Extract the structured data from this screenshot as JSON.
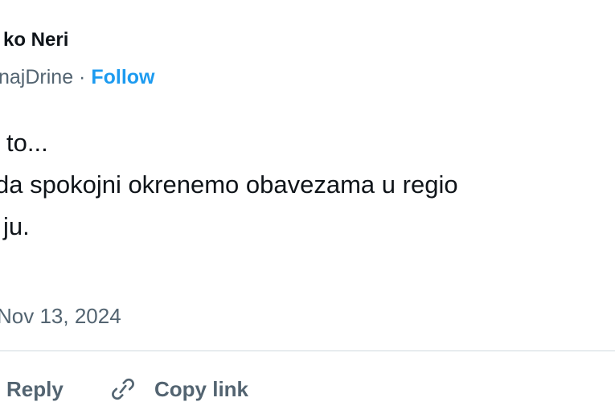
{
  "author": {
    "name": "ko Neri",
    "handle": "najDrine",
    "separator": " · ",
    "follow_label": "Follow"
  },
  "tweet": {
    "lines": [
      "to...",
      "da spokojni okrenemo obavezama u regio",
      "ju."
    ],
    "timestamp": "Nov 13, 2024"
  },
  "actions": {
    "reply_label": "Reply",
    "copy_link_label": "Copy link",
    "copy_link_icon": "link-icon"
  },
  "colors": {
    "text": "#0f1419",
    "secondary": "#536471",
    "accent": "#1d9bf0",
    "divider": "#cfd9de"
  }
}
